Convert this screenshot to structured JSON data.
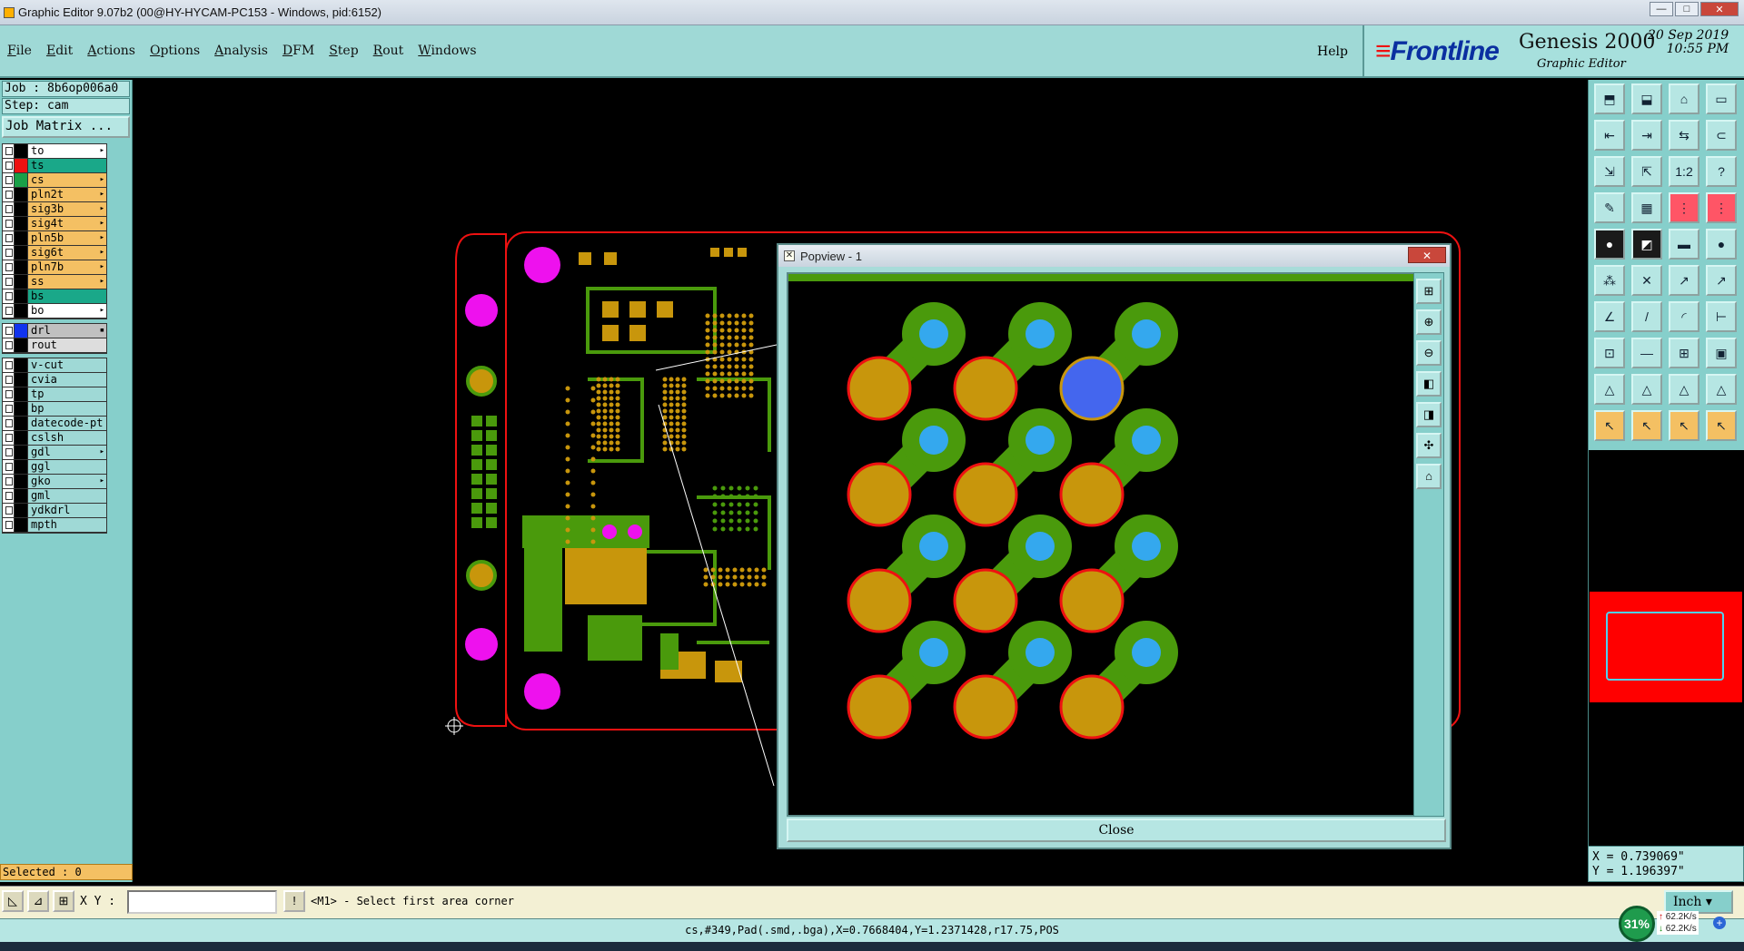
{
  "window": {
    "title": "Graphic Editor 9.07b2 (00@HY-HYCAM-PC153 - Windows, pid:6152)",
    "controls": [
      "—",
      "□",
      "✕"
    ]
  },
  "menu": {
    "items": [
      "File",
      "Edit",
      "Actions",
      "Options",
      "Analysis",
      "DFM",
      "Step",
      "Rout",
      "Windows"
    ],
    "help": "Help"
  },
  "brand": {
    "logo": "Frontline",
    "product": "Genesis 2000",
    "subtitle": "Graphic Editor",
    "date": "20 Sep 2019",
    "time": "10:55 PM"
  },
  "job": {
    "job_line": "Job : 8b6op006a0",
    "step_line": "Step: cam",
    "matrix_button": "Job Matrix ..."
  },
  "layers_group1": [
    {
      "name": "to",
      "swatch": "#000000",
      "bg": "#ffffff",
      "arrow": "▸"
    },
    {
      "name": "ts",
      "swatch": "#ee1111",
      "bg": "#1aa889",
      "arrow": ""
    },
    {
      "name": "cs",
      "swatch": "#1aa048",
      "bg": "#f4c063",
      "arrow": "▸"
    },
    {
      "name": "pln2t",
      "swatch": "#000000",
      "bg": "#f4c063",
      "arrow": "▸"
    },
    {
      "name": "sig3b",
      "swatch": "#000000",
      "bg": "#f4c063",
      "arrow": "▸"
    },
    {
      "name": "sig4t",
      "swatch": "#000000",
      "bg": "#f4c063",
      "arrow": "▸"
    },
    {
      "name": "pln5b",
      "swatch": "#000000",
      "bg": "#f4c063",
      "arrow": "▸"
    },
    {
      "name": "sig6t",
      "swatch": "#000000",
      "bg": "#f4c063",
      "arrow": "▸"
    },
    {
      "name": "pln7b",
      "swatch": "#000000",
      "bg": "#f4c063",
      "arrow": "▸"
    },
    {
      "name": "ss",
      "swatch": "#000000",
      "bg": "#f4c063",
      "arrow": "▸"
    },
    {
      "name": "bs",
      "swatch": "#000000",
      "bg": "#1aa889",
      "arrow": ""
    },
    {
      "name": "bo",
      "swatch": "#000000",
      "bg": "#ffffff",
      "arrow": "▸"
    }
  ],
  "layers_group2": [
    {
      "name": "drl",
      "swatch": "#1133ee",
      "bg": "#c0c0c0",
      "arrow": "▪"
    },
    {
      "name": "rout",
      "swatch": "#000000",
      "bg": "#dddddd",
      "arrow": ""
    }
  ],
  "layers_group3": [
    {
      "name": "v-cut",
      "swatch": "#000000",
      "bg": "#9fd9d6",
      "arrow": ""
    },
    {
      "name": "cvia",
      "swatch": "#000000",
      "bg": "#9fd9d6",
      "arrow": ""
    },
    {
      "name": "tp",
      "swatch": "#000000",
      "bg": "#9fd9d6",
      "arrow": ""
    },
    {
      "name": "bp",
      "swatch": "#000000",
      "bg": "#9fd9d6",
      "arrow": ""
    },
    {
      "name": "datecode-pt",
      "swatch": "#000000",
      "bg": "#9fd9d6",
      "arrow": ""
    },
    {
      "name": "cslsh",
      "swatch": "#000000",
      "bg": "#9fd9d6",
      "arrow": ""
    },
    {
      "name": "gdl",
      "swatch": "#000000",
      "bg": "#9fd9d6",
      "arrow": "▸"
    },
    {
      "name": "ggl",
      "swatch": "#000000",
      "bg": "#9fd9d6",
      "arrow": ""
    },
    {
      "name": "gko",
      "swatch": "#000000",
      "bg": "#9fd9d6",
      "arrow": "▸"
    },
    {
      "name": "gml",
      "swatch": "#000000",
      "bg": "#9fd9d6",
      "arrow": ""
    },
    {
      "name": "ydkdrl",
      "swatch": "#000000",
      "bg": "#9fd9d6",
      "arrow": ""
    },
    {
      "name": "mpth",
      "swatch": "#000000",
      "bg": "#9fd9d6",
      "arrow": ""
    }
  ],
  "selected": "Selected : 0",
  "popview": {
    "title": "Popview - 1",
    "close_button": "Close",
    "close_x": "✕"
  },
  "coords": {
    "x": "X = 0.739069\"",
    "y": "Y = 1.196397\""
  },
  "bottom": {
    "xy_label": "X Y :",
    "xy_value": "",
    "prompt": "<M1> - Select first area corner",
    "units": "Inch"
  },
  "status": "cs,#349,Pad(.smd,.bga),X=0.7668404,Y=1.2371428,r17.75,POS",
  "net": {
    "percent": "31%",
    "up": "62.2K/s",
    "down": "62.2K/s"
  },
  "colors": {
    "copper": "#c8960c",
    "trace": "#4a9a0c",
    "drill": "#34a8ee",
    "outline": "#ee1111",
    "highlight": "#4466ee",
    "magenta": "#ee11ee"
  }
}
